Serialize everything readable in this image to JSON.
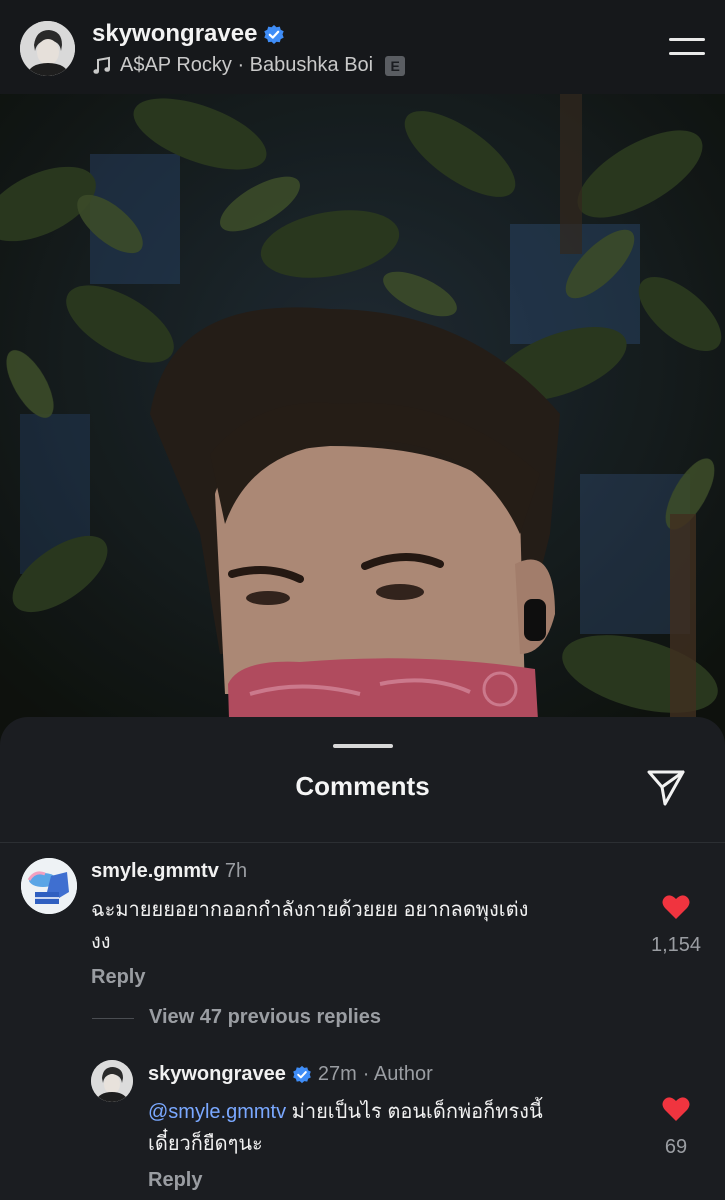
{
  "header": {
    "username": "skywongravee",
    "music": "A$AP Rocky · Babushka Boi",
    "explicit_badge": "E",
    "icons": [
      "music-note-icon",
      "verified-icon",
      "menu-icon"
    ]
  },
  "sheet": {
    "title": "Comments",
    "share_icon": "send-icon"
  },
  "comments": [
    {
      "username": "smyle.gmmtv",
      "time": "7h",
      "text_line1": "ฉะมายยยอยากออกกำลังกายด้วยยย อยากลดพุงเต่ง",
      "text_line2": "งง",
      "reply_label": "Reply",
      "likes": "1,154"
    }
  ],
  "view_replies": "View 47 previous replies",
  "reply_comment": {
    "username": "skywongravee",
    "time": "27m",
    "author_label": "· Author",
    "mention": "@smyle.gmmtv",
    "text_line1": " ม่ายเป็นไร ตอนเด็กพ่อก็ทรงนี้",
    "text_line2": "เดี๋ยวก็ยืดๆนะ",
    "reply_label": "Reply",
    "likes": "69"
  },
  "colors": {
    "background": "#1b1d21",
    "heart": "#f0343f",
    "verified": "#3f8df7",
    "mention": "#7aa8ff"
  }
}
